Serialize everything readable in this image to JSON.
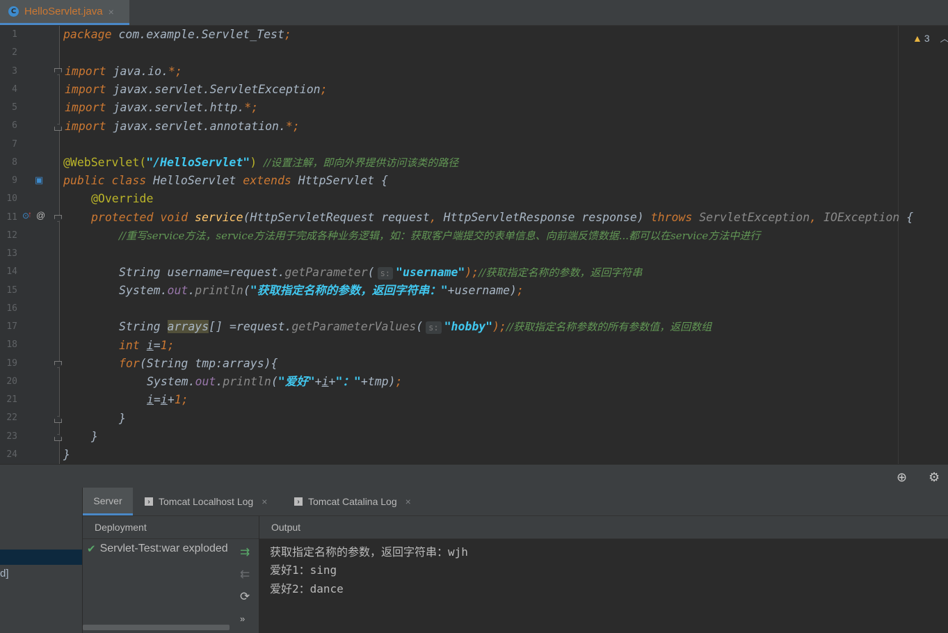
{
  "tab": {
    "icon": "C",
    "label": "HelloServlet.java",
    "close": "×"
  },
  "inspections": {
    "warning_count": "3"
  },
  "code": {
    "l1": [
      "package",
      " com.example.Servlet_Test",
      ";"
    ],
    "l3": [
      "import",
      " java.io.",
      "*",
      ";"
    ],
    "l4": [
      "import",
      " javax.servlet.ServletException",
      ";"
    ],
    "l5": [
      "import",
      " javax.servlet.http.",
      "*",
      ";"
    ],
    "l6": [
      "import",
      " javax.servlet.annotation.",
      "*",
      ";"
    ],
    "l8": [
      "@WebServlet(",
      "\"/HelloServlet\"",
      ") ",
      "//设置注解，即向外界提供访问该类的路径"
    ],
    "l9": [
      "public class",
      " HelloServlet ",
      "extends",
      " HttpServlet {"
    ],
    "l10": [
      "@Override"
    ],
    "l11": [
      "protected void",
      " ",
      "service",
      "(HttpServletRequest request",
      ", ",
      "HttpServletResponse response) ",
      "throws",
      " ServletException",
      ", ",
      "IOException",
      " {"
    ],
    "l12": [
      "//重写service方法，service方法用于完成各种业务逻辑，如：获取客户端提交的表单信息、向前端反馈数据...都可以在service方法中进行"
    ],
    "l14": [
      "String username=request.",
      "getParameter",
      "(",
      "s:",
      "\"username\"",
      ");",
      "//获取指定名称的参数，返回字符串"
    ],
    "l15": [
      "System.",
      "out",
      ".",
      "println",
      "(",
      "\"获取指定名称的参数，返回字符串：\"",
      "+username)",
      ";"
    ],
    "l17": [
      "String ",
      "arrays",
      "[] =request.",
      "getParameterValues",
      "(",
      "s:",
      "\"hobby\"",
      ");",
      "//获取指定名称参数的所有参数值，返回数组"
    ],
    "l18": [
      "int",
      " ",
      "i",
      "=",
      "1",
      ";"
    ],
    "l19": [
      "for",
      "(String tmp:arrays){"
    ],
    "l20": [
      "System.",
      "out",
      ".",
      "println",
      "(",
      "\"爱好\"",
      "+",
      "i",
      "+",
      "\"：\"",
      "+tmp)",
      ";"
    ],
    "l21": [
      "i",
      "=",
      "i",
      "+",
      "1",
      ";"
    ],
    "l22": [
      "}"
    ],
    "l23": [
      "}"
    ],
    "l24": [
      "}"
    ]
  },
  "line_numbers": [
    "1",
    "2",
    "3",
    "4",
    "5",
    "6",
    "7",
    "8",
    "9",
    "10",
    "11",
    "12",
    "13",
    "14",
    "15",
    "16",
    "17",
    "18",
    "19",
    "20",
    "21",
    "22",
    "23",
    "24"
  ],
  "bottom": {
    "tabs": {
      "server": "Server",
      "localhost_log": "Tomcat Localhost Log",
      "catalina_log": "Tomcat Catalina Log",
      "close": "×"
    },
    "deployment_header": "Deployment",
    "deployment_item": "Servlet-Test:war exploded",
    "output_header": "Output",
    "output_lines": [
      "获取指定名称的参数，返回字符串：wjh",
      "爱好1：sing",
      "爱好2：dance"
    ],
    "left_bracket": "d]",
    "more": "»"
  },
  "colors": {
    "keyword": "#cc7832",
    "string": "#41c8f0",
    "comment": "#629755",
    "accent": "#4a88c7"
  }
}
